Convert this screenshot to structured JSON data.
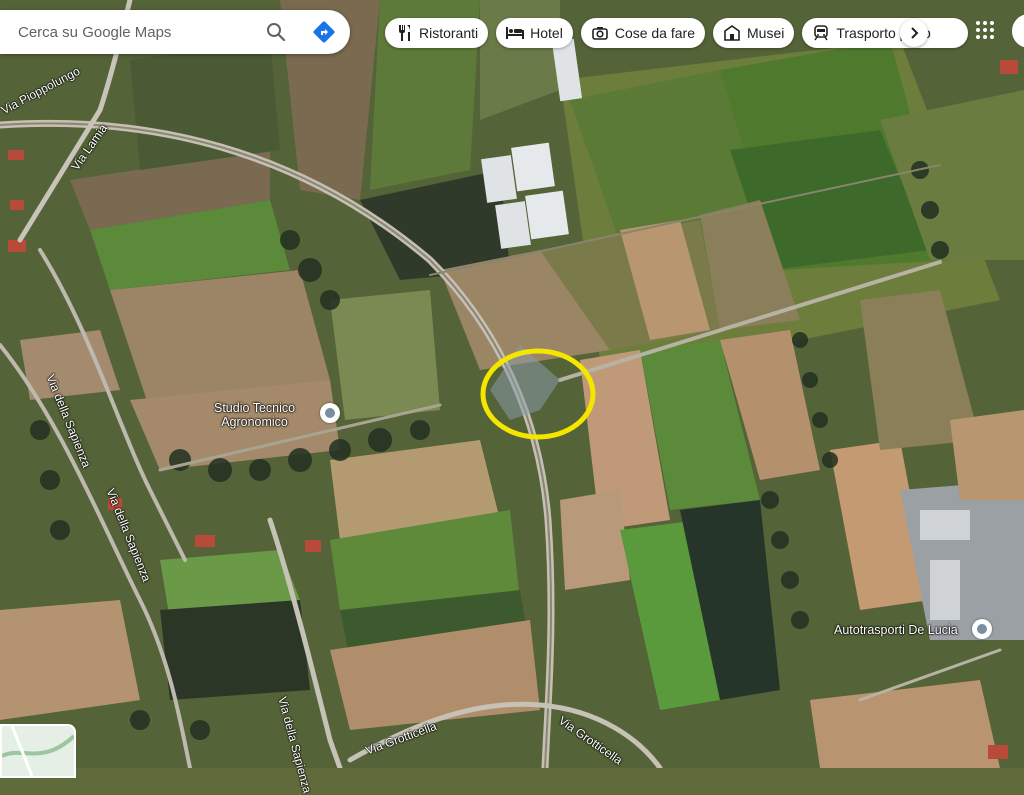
{
  "search": {
    "placeholder": "Cerca su Google Maps"
  },
  "chips": [
    {
      "label": "Ristoranti",
      "icon": "fork-knife-icon"
    },
    {
      "label": "Hotel",
      "icon": "bed-icon"
    },
    {
      "label": "Cose da fare",
      "icon": "camera-icon"
    },
    {
      "label": "Musei",
      "icon": "museum-icon"
    },
    {
      "label": "Trasporto pubb",
      "icon": "train-icon"
    }
  ],
  "roads": {
    "via_pioppolungo": "Via Pioppolungo",
    "via_lamia": "Via Lamia",
    "via_sapienza_1": "Via della Sapienza",
    "via_sapienza_2": "Via della Sapienza",
    "via_sapienza_3": "Via della Sapienza",
    "via_grotticella_1": "Via Grotticella",
    "via_grotticella_2": "Via Grotticella"
  },
  "places": {
    "studio": "Studio Tecnico\nAgronomico",
    "autotrasporti": "Autotrasporti De Lucia"
  },
  "colors": {
    "highlight": "#f5e600",
    "accent": "#1a73e8",
    "directions": "#1a73e8"
  }
}
